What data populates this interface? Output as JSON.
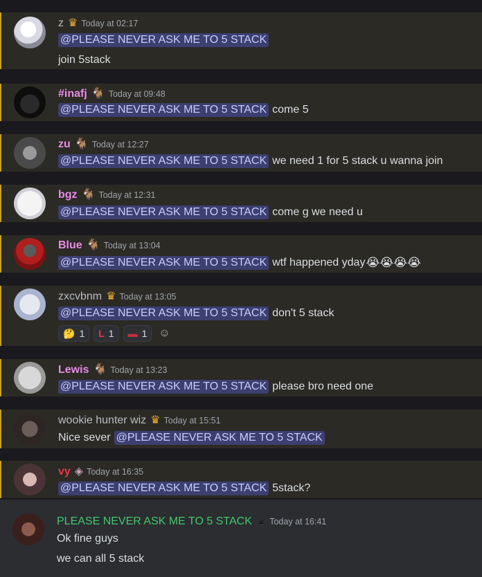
{
  "colors": {
    "mention_bg": "#3c3f70",
    "mention_text": "#c9cdfb",
    "highlight_bar": "#c9a227",
    "name_pink": "#e88ce6",
    "name_red": "#e8364a",
    "name_green": "#43c96b",
    "name_default": "#b8bcc4"
  },
  "messages": [
    {
      "name": "z",
      "badge": "crown-icon",
      "timestamp": "Today at 02:17",
      "mention": "@PLEASE NEVER ASK ME TO 5 STACK",
      "text": "",
      "extra_line": "join 5stack"
    },
    {
      "name": "#inafj",
      "badge": "goat-icon",
      "timestamp": "Today at 09:48",
      "mention": "@PLEASE NEVER ASK ME TO 5 STACK",
      "text": "come 5"
    },
    {
      "name": "zu",
      "badge": "goat-icon",
      "timestamp": "Today at 12:27",
      "mention": "@PLEASE NEVER ASK ME TO 5 STACK",
      "text": "we need 1 for 5 stack u wanna join"
    },
    {
      "name": "bgz",
      "badge": "goat-icon",
      "timestamp": "Today at 12:31",
      "mention": "@PLEASE NEVER ASK ME TO 5 STACK",
      "text": "come g we need u"
    },
    {
      "name": "Blue",
      "badge": "goat-icon",
      "timestamp": "Today at 13:04",
      "mention": "@PLEASE NEVER ASK ME TO 5 STACK",
      "text": "wtf happened yday",
      "emojis": "😭😭😭😭"
    },
    {
      "name": "zxcvbnm",
      "badge": "crown-icon",
      "timestamp": "Today at 13:05",
      "mention": "@PLEASE NEVER ASK ME TO 5 STACK",
      "text": "don't 5 stack",
      "reactions": [
        {
          "icon": "thinking-emoji",
          "glyph": "🤔",
          "count": "1"
        },
        {
          "icon": "l-emoji",
          "glyph": "L",
          "count": "1"
        },
        {
          "icon": "custom-emoji",
          "glyph": "▬",
          "count": "1"
        }
      ]
    },
    {
      "name": "Lewis",
      "badge": "goat-icon",
      "timestamp": "Today at 13:23",
      "mention": "@PLEASE NEVER ASK ME TO 5 STACK",
      "text": "please bro need one"
    },
    {
      "name": "wookie hunter wiz",
      "badge": "crown-icon",
      "timestamp": "Today at 15:51",
      "prefix": "Nice sever",
      "mention": "@PLEASE NEVER ASK ME TO 5 STACK"
    },
    {
      "name": "vy",
      "badge": "diamond-icon",
      "timestamp": "Today at 16:35",
      "mention": "@PLEASE NEVER ASK ME TO 5 STACK",
      "text": "5stack?"
    },
    {
      "name": "PLEASE NEVER ASK ME TO 5 STACK",
      "badge": "black-crown-icon",
      "timestamp": "Today at 16:41",
      "line1": "Ok fine guys",
      "line2": "we can all 5 stack"
    }
  ]
}
